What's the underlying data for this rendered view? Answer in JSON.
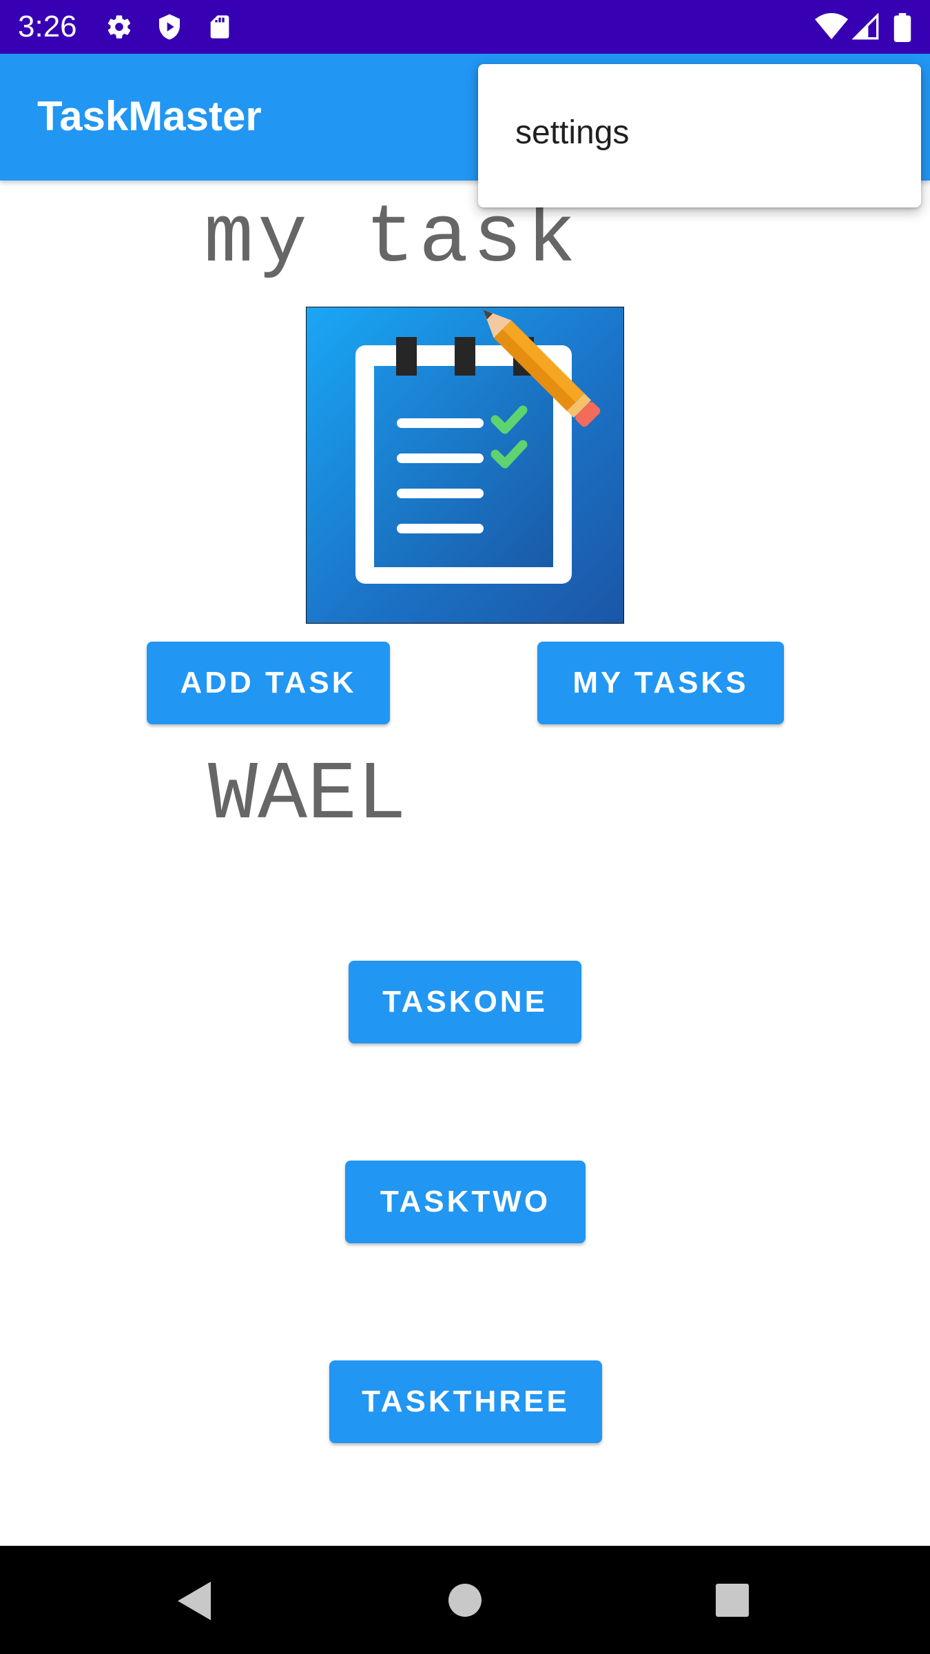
{
  "status_bar": {
    "time": "3:26",
    "background": "#3700b3",
    "left_icons": [
      "gear-icon",
      "shield-play-icon",
      "sd-card-icon"
    ],
    "right_icons": [
      "wifi-icon",
      "signal-icon",
      "battery-icon"
    ]
  },
  "app_bar": {
    "title": "TaskMaster",
    "background": "#2196f3"
  },
  "overflow_menu": {
    "items": [
      {
        "label": "settings"
      }
    ]
  },
  "main": {
    "heading": "my task",
    "logo_icon": "notepad-checklist-pencil-icon",
    "add_task_label": "ADD TASK",
    "my_tasks_label": "MY TASKS",
    "username": "WAEL",
    "task_buttons": [
      {
        "label": "TASKONE"
      },
      {
        "label": "TASKTWO"
      },
      {
        "label": "TASKTHREE"
      }
    ],
    "button_color": "#2196f3"
  },
  "nav_bar": {
    "buttons": [
      "back-icon",
      "home-icon",
      "recents-icon"
    ]
  }
}
